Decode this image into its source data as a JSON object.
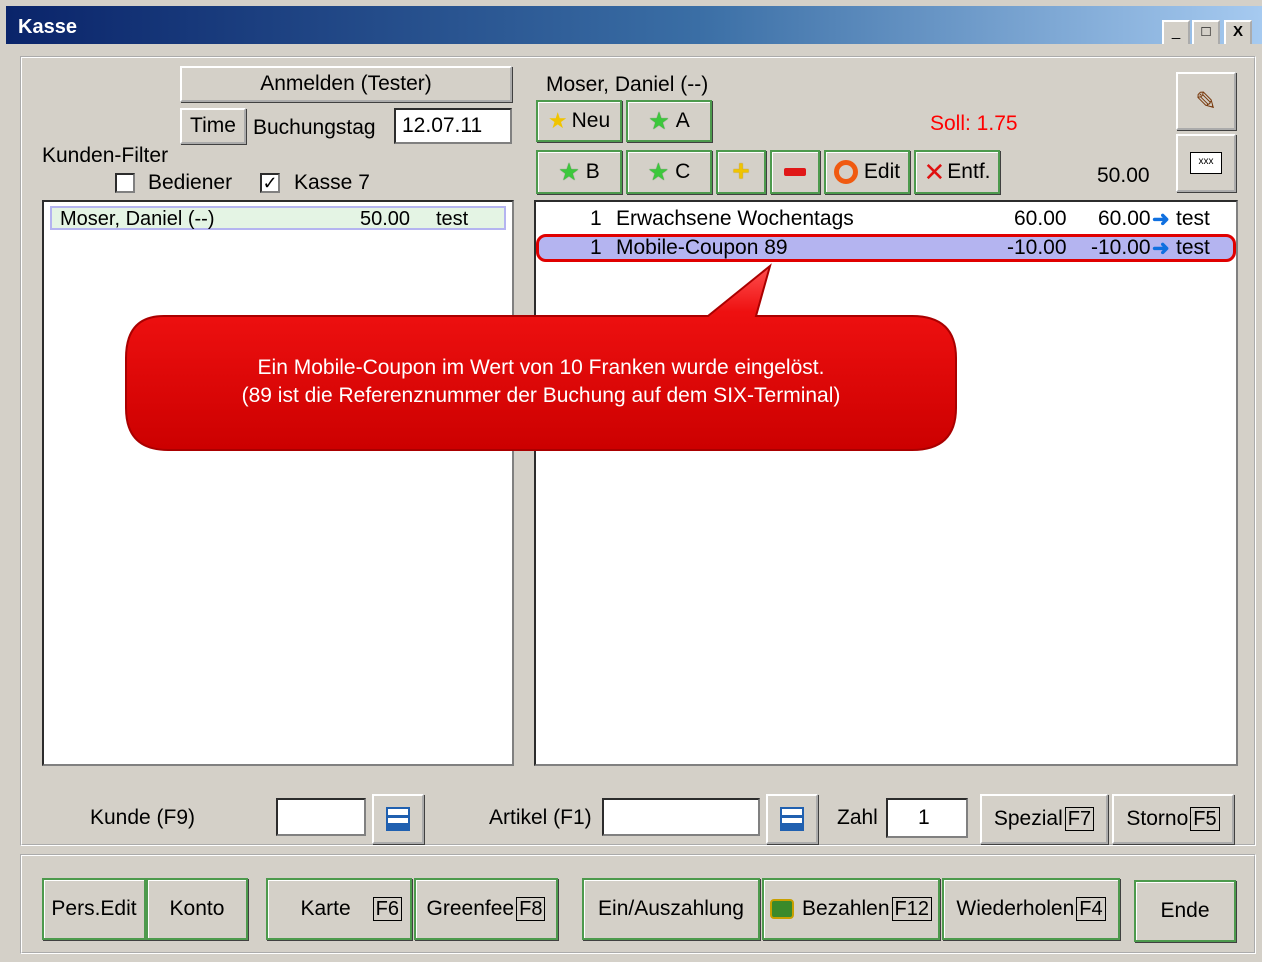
{
  "window": {
    "title": "Kasse",
    "minimize": "_",
    "maximize": "□",
    "close": "X"
  },
  "left": {
    "login_button": "Anmelden (Tester)",
    "time_button": "Time",
    "buchungstag_label": "Buchungstag",
    "buchungstag_value": "12.07.11",
    "filter_label": "Kunden-Filter",
    "bediener_label": "Bediener",
    "bediener_checked": "",
    "kasse_label": "Kasse 7",
    "kasse_checked": "✓",
    "customers": [
      {
        "name": "Moser, Daniel (--)",
        "amount": "50.00",
        "note": "test"
      }
    ]
  },
  "right": {
    "customer_name": "Moser, Daniel (--)",
    "soll": "Soll: 1.75",
    "total": "50.00",
    "buttons": {
      "neu": "Neu",
      "a": "A",
      "b": "B",
      "c": "C",
      "edit": "Edit",
      "entf": "Entf."
    },
    "items": [
      {
        "qty": "1",
        "name": "Erwachsene Wochentags",
        "price": "60.00",
        "total": "60.00",
        "note": "test"
      },
      {
        "qty": "1",
        "name": "Mobile-Coupon 89",
        "price": "-10.00",
        "total": "-10.00",
        "note": "test"
      }
    ],
    "callout_line1": "Ein Mobile-Coupon im Wert von 10 Franken wurde eingelöst.",
    "callout_line2": "(89 ist die Referenznummer der Buchung auf dem SIX-Terminal)"
  },
  "bottom_inputs": {
    "kunde_label": "Kunde (F9)",
    "kunde_value": "",
    "artikel_label": "Artikel (F1)",
    "artikel_value": "",
    "zahl_label": "Zahl",
    "zahl_value": "1",
    "spezial_label": "Spezial",
    "spezial_key": "F7",
    "storno_label": "Storno",
    "storno_key": "F5"
  },
  "footer": {
    "pers_edit": "Pers.Edit",
    "konto": "Konto",
    "karte": "Karte",
    "karte_key": "F6",
    "greenfee": "Greenfee",
    "greenfee_key": "F8",
    "einauszahlung": "Ein/Auszahlung",
    "bezahlen": "Bezahlen",
    "bezahlen_key": "F12",
    "wiederholen": "Wiederholen",
    "wiederholen_key": "F4",
    "ende": "Ende"
  },
  "colors": {
    "titlebar": "#0a246a",
    "soll": "#ff0000",
    "callout": "#dd0000",
    "selection": "#b4b4f0"
  }
}
